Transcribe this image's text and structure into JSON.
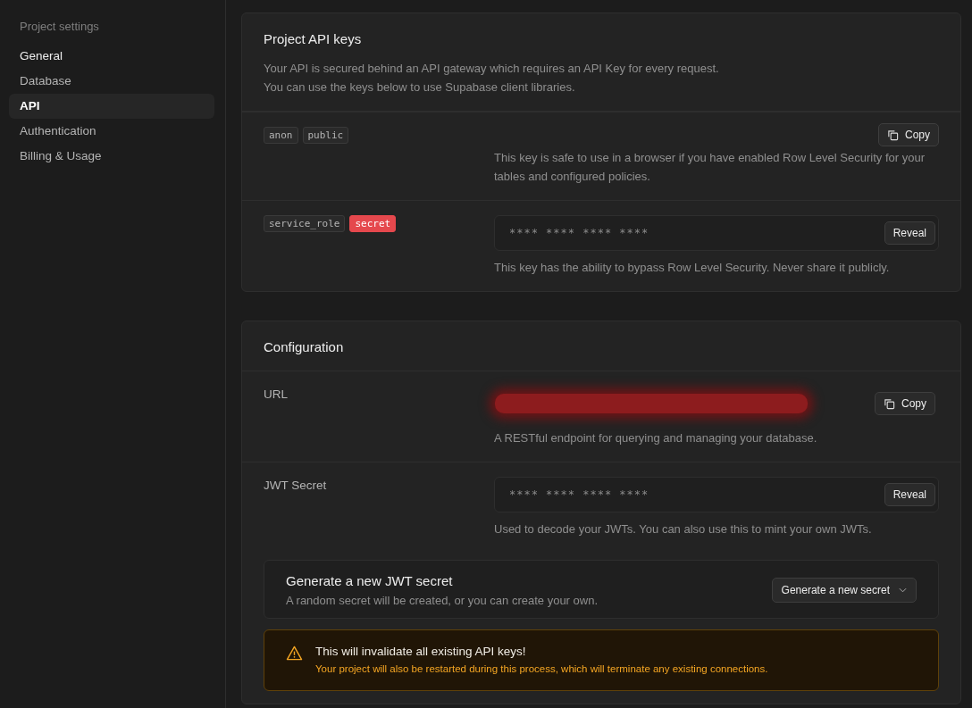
{
  "sidebar": {
    "heading": "Project settings",
    "items": [
      {
        "label": "General",
        "selected": false
      },
      {
        "label": "Database",
        "selected": false
      },
      {
        "label": "API",
        "selected": true
      },
      {
        "label": "Authentication",
        "selected": false
      },
      {
        "label": "Billing & Usage",
        "selected": false
      }
    ]
  },
  "api_keys": {
    "title": "Project API keys",
    "description": [
      "Your API is secured behind an API gateway which requires an API Key for every request.",
      "You can use the keys below to use Supabase client libraries."
    ],
    "rows": [
      {
        "tags": [
          {
            "label": "anon",
            "kind": "plain"
          },
          {
            "label": "public",
            "kind": "plain"
          }
        ],
        "kind": "button",
        "button": "Copy",
        "note": "This key is safe to use in a browser if you have enabled Row Level Security for your tables and configured policies."
      },
      {
        "tags": [
          {
            "label": "service_role",
            "kind": "plain"
          },
          {
            "label": "secret",
            "kind": "danger"
          }
        ],
        "kind": "masked",
        "value": "**** **** **** ****",
        "button": "Reveal",
        "note": "This key has the ability to bypass Row Level Security. Never share it publicly."
      }
    ]
  },
  "configuration": {
    "title": "Configuration",
    "rows": [
      {
        "label": "URL",
        "kind": "redacted",
        "button": "Copy",
        "note": "A RESTful endpoint for querying and managing your database."
      },
      {
        "label": "JWT Secret",
        "kind": "masked",
        "value": "**** **** **** ****",
        "button": "Reveal",
        "note": "Used to decode your JWTs. You can also use this to mint your own JWTs."
      }
    ],
    "generate": {
      "title": "Generate a new JWT secret",
      "description": "A random secret will be created, or you can create your own.",
      "button": "Generate a new secret"
    },
    "warning": {
      "title": "This will invalidate all existing API keys!",
      "body": "Your project will also be restarted during this process, which will terminate any existing connections."
    }
  }
}
